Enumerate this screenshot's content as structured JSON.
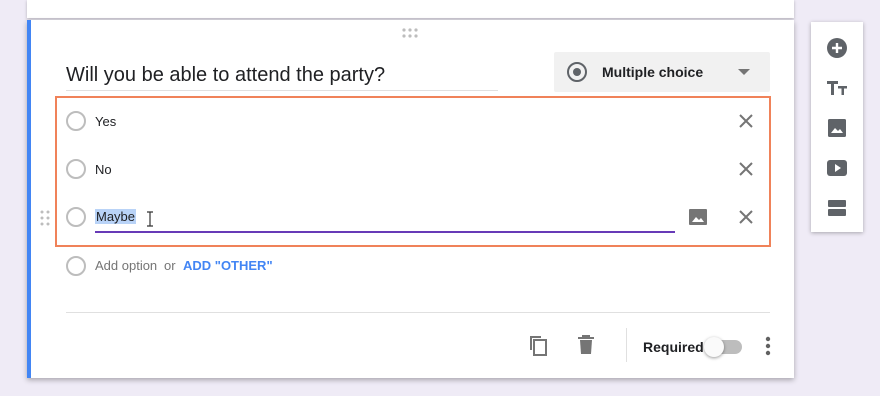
{
  "question": {
    "title": "Will you be able to attend the party?"
  },
  "question_type": {
    "selected": "Multiple choice"
  },
  "options": [
    {
      "label": "Yes"
    },
    {
      "label": "No"
    },
    {
      "label": "Maybe",
      "selected_text": true
    }
  ],
  "add_option": {
    "label": "Add option",
    "separator": "or",
    "add_other": "ADD \"OTHER\""
  },
  "footer": {
    "required_label": "Required",
    "required_on": false
  },
  "sidebar": {
    "items": [
      {
        "icon": "add-circle-icon",
        "action": "add-question"
      },
      {
        "icon": "title-text-icon",
        "action": "add-title"
      },
      {
        "icon": "image-icon",
        "action": "add-image"
      },
      {
        "icon": "video-icon",
        "action": "add-video"
      },
      {
        "icon": "section-icon",
        "action": "add-section"
      }
    ]
  },
  "colors": {
    "background": "#efebf6",
    "accent_blue": "#4285f4",
    "focus_purple": "#673ab7",
    "highlight_border": "#f08259",
    "text_selection": "#b9d3f7"
  }
}
